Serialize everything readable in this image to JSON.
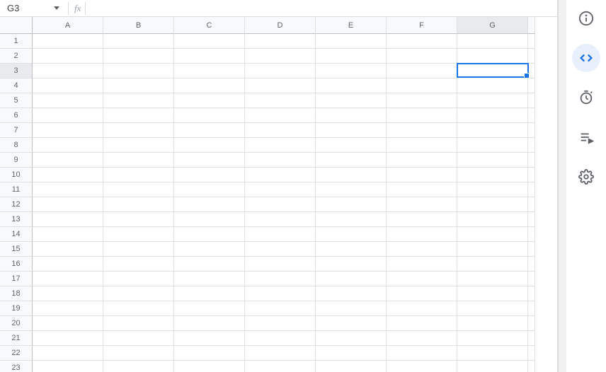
{
  "formula_bar": {
    "cell_reference": "G3",
    "fx_label": "fx",
    "formula_value": ""
  },
  "grid": {
    "columns": [
      "A",
      "B",
      "C",
      "D",
      "E",
      "F",
      "G"
    ],
    "rows": [
      "1",
      "2",
      "3",
      "4",
      "5",
      "6",
      "7",
      "8",
      "9",
      "10",
      "11",
      "12",
      "13",
      "14",
      "15",
      "16",
      "17",
      "18",
      "19",
      "20",
      "21",
      "22",
      "23"
    ],
    "selected_cell": {
      "col": "G",
      "row": "3"
    },
    "cells": {}
  },
  "side_panel": {
    "items": [
      {
        "name": "info",
        "active": false
      },
      {
        "name": "code",
        "active": true
      },
      {
        "name": "clock",
        "active": false
      },
      {
        "name": "playlist",
        "active": false
      },
      {
        "name": "settings",
        "active": false
      }
    ]
  }
}
